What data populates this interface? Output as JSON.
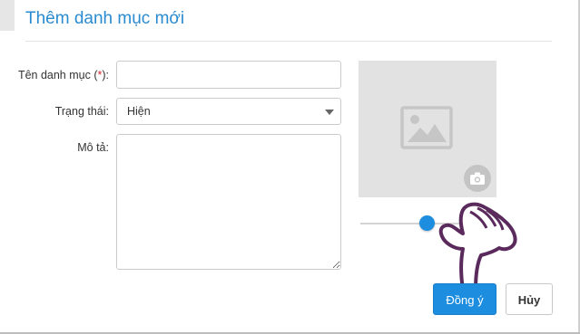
{
  "dialog": {
    "title": "Thêm danh mục mới"
  },
  "form": {
    "name_label": "Tên danh mục (",
    "name_required_mark": "*",
    "name_label_end": "):",
    "name_value": "",
    "status_label": "Trạng thái:",
    "status_selected": "Hiện",
    "description_label": "Mô tả:",
    "description_value": ""
  },
  "image_panel": {
    "placeholder_icon": "image-placeholder-icon",
    "camera_icon": "camera-icon",
    "slider_value": 0.5
  },
  "actions": {
    "ok_label": "Đồng ý",
    "cancel_label": "Hủy"
  },
  "colors": {
    "accent": "#1d8de0",
    "title": "#2a8bd0",
    "required": "#d0262b",
    "image_bg": "#e2e2e2",
    "hand_outline": "#5a2a5c"
  }
}
